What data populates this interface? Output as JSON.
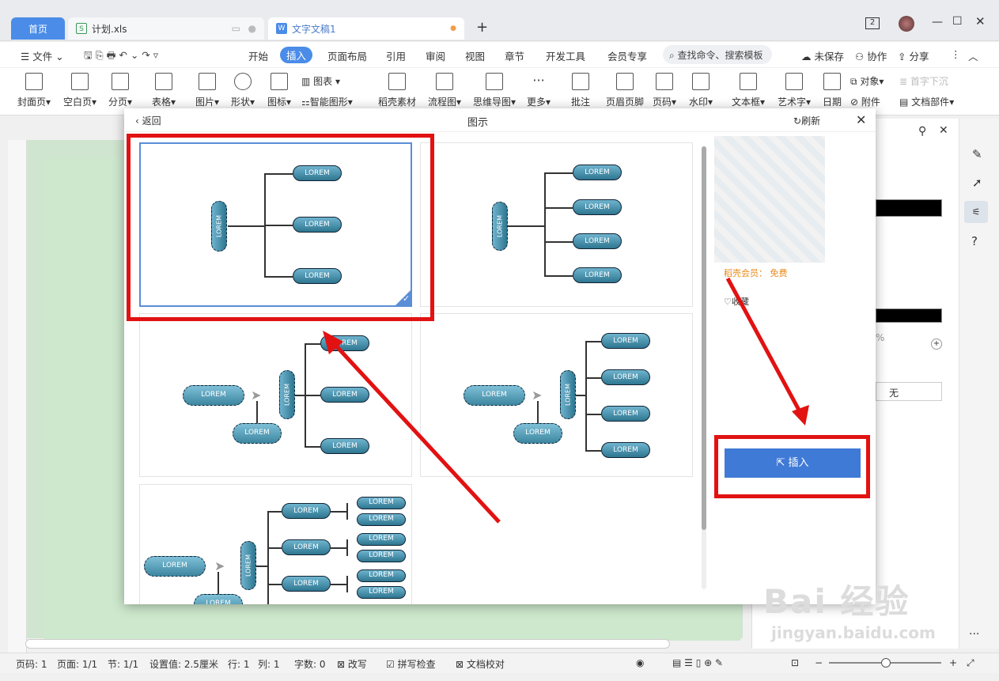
{
  "tabs": {
    "home": "首页",
    "xls": "计划.xls",
    "doc": "文字文稿1",
    "add": "+"
  },
  "window": {
    "badge": "2"
  },
  "menu": {
    "file": "文件",
    "items": [
      "开始",
      "插入",
      "页面布局",
      "引用",
      "审阅",
      "视图",
      "章节",
      "开发工具",
      "会员专享"
    ],
    "search": "查找命令、搜索模板",
    "unsaved": "未保存",
    "collab": "协作",
    "share": "分享"
  },
  "toolbar": {
    "items": [
      "封面页",
      "空白页",
      "分页",
      "表格",
      "图片",
      "形状",
      "图标",
      "稻壳素材",
      "流程图",
      "思维导图",
      "更多",
      "批注",
      "页眉页脚",
      "页码",
      "水印",
      "文本框",
      "艺术字",
      "日期",
      "附件",
      "文档部件"
    ],
    "chart": "图表",
    "smart": "智能图形",
    "object": "对象",
    "dropcap": "首字下沉"
  },
  "dialog": {
    "back": "返回",
    "title": "图示",
    "refresh": "刷新",
    "member_label": "稻壳会员：",
    "member_value": "免费",
    "collect": "收藏",
    "insert": "插入",
    "pill": "LOREM"
  },
  "rightpane": {
    "percent": "%",
    "select_none": "无"
  },
  "status": {
    "page": "页码: 1",
    "pages": "页面: 1/1",
    "section": "节: 1/1",
    "setting": "设置值: 2.5厘米",
    "row": "行: 1",
    "col": "列: 1",
    "words": "字数: 0",
    "overwrite": "改写",
    "spell": "拼写检查",
    "proof": "文档校对"
  },
  "watermark": {
    "brand": "Bai  经验",
    "url": "jingyan.baidu.com"
  },
  "colors": {
    "accent": "#4a8ce8",
    "insert_button": "#3f7ad6",
    "annotation_red": "#e21212"
  }
}
